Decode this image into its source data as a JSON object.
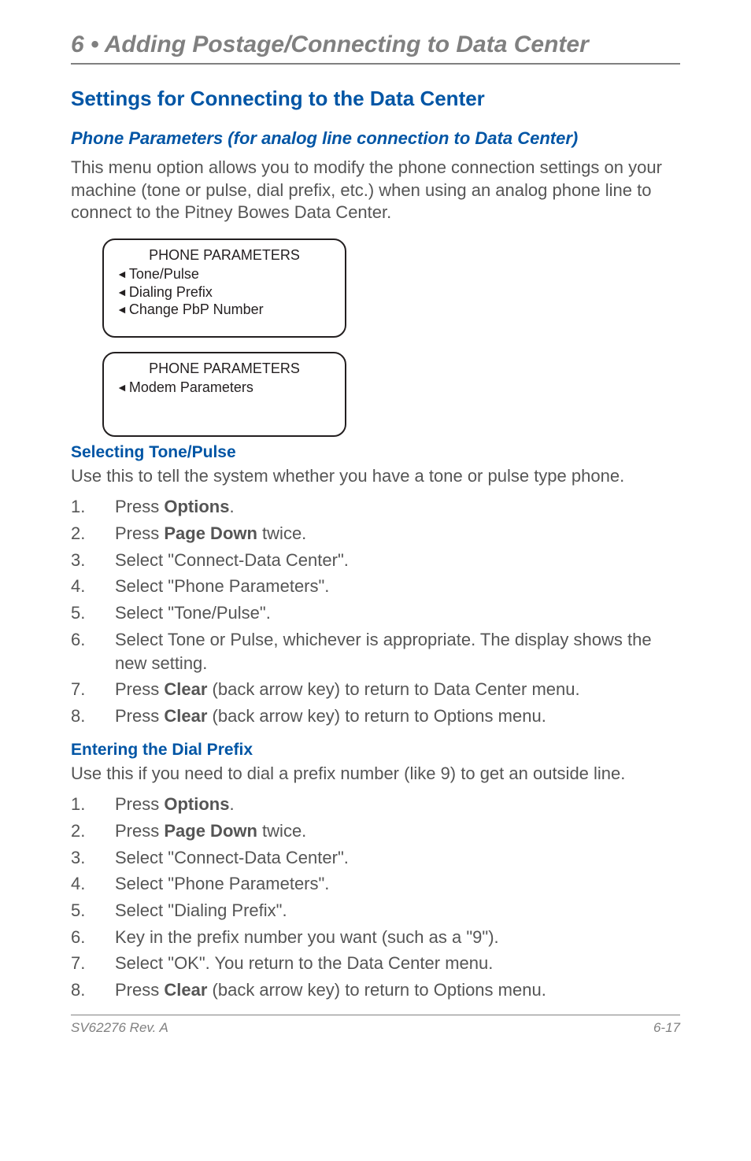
{
  "chapter_header": "6 • Adding Postage/Connecting to Data Center",
  "section_title": "Settings for Connecting to the Data Center",
  "subsection_title": "Phone Parameters (for analog line connection to Data Center)",
  "intro_paragraph": "This menu option allows you to modify the phone connection settings on your machine (tone or pulse, dial prefix, etc.) when using an analog phone line to connect to the Pitney Bowes Data Center.",
  "panel1": {
    "title": "PHONE PARAMETERS",
    "lines": [
      "Tone/Pulse",
      "Dialing Prefix",
      "Change PbP Number"
    ]
  },
  "panel2": {
    "title": "PHONE PARAMETERS",
    "lines": [
      "Modem Parameters"
    ]
  },
  "tone_pulse": {
    "heading": "Selecting Tone/Pulse",
    "lead": "Use this to tell the system whether you have a tone or pulse type phone.",
    "steps": [
      {
        "pre": "Press ",
        "bold": "Options",
        "post": "."
      },
      {
        "pre": "Press ",
        "bold": "Page Down",
        "post": " twice."
      },
      {
        "plain": "Select \"Connect-Data Center\"."
      },
      {
        "plain": "Select \"Phone Parameters\"."
      },
      {
        "plain": "Select \"Tone/Pulse\"."
      },
      {
        "plain": "Select Tone or Pulse, whichever is appropriate. The display shows the new setting."
      },
      {
        "pre": "Press ",
        "bold": "Clear",
        "post": " (back arrow key) to return to Data Center menu."
      },
      {
        "pre": "Press ",
        "bold": "Clear",
        "post": " (back arrow key) to return to Options menu."
      }
    ]
  },
  "dial_prefix": {
    "heading": "Entering the Dial Prefix",
    "lead": "Use this if you need to dial a prefix number (like 9) to get an outside line.",
    "steps": [
      {
        "pre": "Press ",
        "bold": "Options",
        "post": "."
      },
      {
        "pre": "Press ",
        "bold": "Page Down",
        "post": " twice."
      },
      {
        "plain": "Select \"Connect-Data Center\"."
      },
      {
        "plain": "Select \"Phone Parameters\"."
      },
      {
        "plain": "Select \"Dialing Prefix\"."
      },
      {
        "plain": "Key in the prefix number you want (such as a \"9\")."
      },
      {
        "plain": "Select \"OK\". You return to the Data Center menu."
      },
      {
        "pre": "Press ",
        "bold": "Clear",
        "post": " (back arrow key) to return to Options menu."
      }
    ]
  },
  "footer_left": "SV62276 Rev. A",
  "footer_right": "6-17"
}
